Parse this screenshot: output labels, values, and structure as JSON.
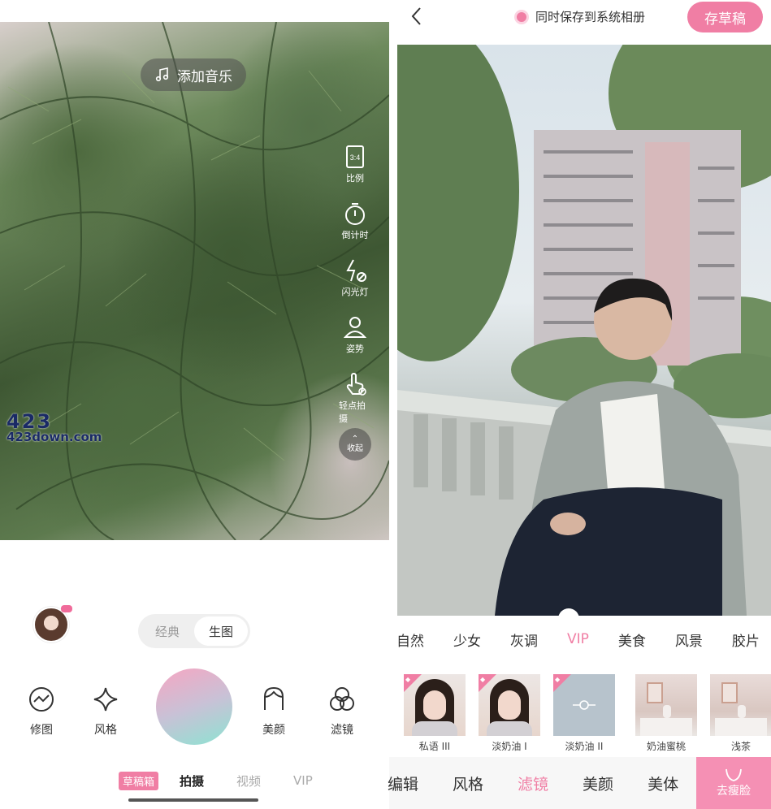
{
  "camera": {
    "music_label": "添加音乐",
    "side_tools": [
      {
        "label": "比例",
        "icon": "ratio-icon",
        "badge": "3:4"
      },
      {
        "label": "倒计时",
        "icon": "timer-icon"
      },
      {
        "label": "闪光灯",
        "icon": "flash-off-icon"
      },
      {
        "label": "姿势",
        "icon": "pose-icon"
      },
      {
        "label": "轻点拍摄",
        "icon": "touch-shoot-icon"
      }
    ],
    "collapse_label": "收起",
    "watermark_big": "423",
    "watermark_small": "423down.com",
    "mode_toggle": [
      "经典",
      "生图"
    ],
    "tools": [
      "修图",
      "风格",
      "美颜",
      "滤镜"
    ],
    "bottom_tabs": {
      "draft": "草稿箱",
      "shoot": "拍摄",
      "video": "视频",
      "vip": "VIP"
    }
  },
  "editor": {
    "save_to_album": "同时保存到系统相册",
    "save_draft": "存草稿",
    "slider_value": 0.4,
    "categories": [
      "自然",
      "少女",
      "灰调",
      "VIP",
      "美食",
      "风景",
      "胶片"
    ],
    "active_category": "VIP",
    "filters": [
      {
        "name": "私语 III",
        "vip": true
      },
      {
        "name": "淡奶油 I",
        "vip": true
      },
      {
        "name": "淡奶油 II",
        "vip": true
      },
      {
        "name": "奶油蜜桃",
        "vip": false
      },
      {
        "name": "浅茶",
        "vip": false
      }
    ],
    "nav": [
      "编辑",
      "风格",
      "滤镜",
      "美颜",
      "美体"
    ],
    "active_nav": "滤镜",
    "slim_face": "去瘦脸"
  },
  "colors": {
    "accent": "#f07ea4"
  }
}
